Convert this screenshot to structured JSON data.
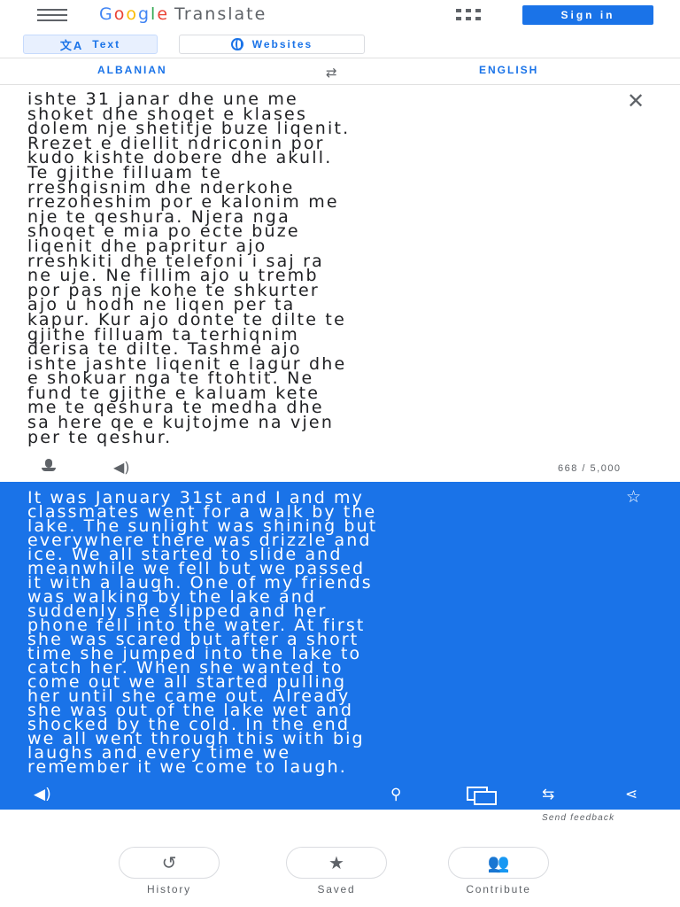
{
  "header": {
    "logo_letters": [
      "G",
      "o",
      "o",
      "g",
      "l",
      "e"
    ],
    "product": "Translate",
    "signin_label": "Sign in",
    "brand_color": "#1a73e8"
  },
  "modes": {
    "text_label": "Text",
    "websites_label": "Websites"
  },
  "languages": {
    "source": "ALBANIAN",
    "target": "ENGLISH"
  },
  "source": {
    "text": "ishte 31 janar dhe une me\nshoket dhe shoqet e klases\ndolem nje shetitje buze liqenit.\nRrezet e diellit ndriconin por\nkudo kishte dobere dhe akull.\nTe gjithe filluam te\nrreshqisnim dhe nderkohe\nrrezoheshim por e kalonim me\nnje te qeshura. Njera nga\nshoqet e mia po ecte buze\nliqenit dhe papritur ajo\nrreshkiti dhe telefoni i saj ra\nne uje. Ne fillim ajo u tremb\npor pas nje kohe te shkurter\najo u hodh ne liqen per ta\nkapur. Kur ajo donte te dilte te\ngjithe filluam ta terhiqnim\nderisa te dilte. Tashme ajo\nishte jashte liqenit e lagur dhe\ne shokuar nga te ftohtit. Ne\nfund te gjithe e kaluam kete\nme te qeshura te medha dhe\nsa here qe e kujtojme na vjen\nper te qeshur.",
    "char_count": "668 / 5,000"
  },
  "result": {
    "text": "It was January 31st and I and my\nclassmates went for a walk by the\nlake. The sunlight was shining but\neverywhere there was drizzle and\nice. We all started to slide and\nmeanwhile we fell but we passed\nit with a laugh. One of my friends\nwas walking by the lake and\nsuddenly she slipped and her\nphone fell into the water. At first\nshe was scared but after a short\ntime she jumped into the lake to\ncatch her. When she wanted to\ncome out we all started pulling\nher until she came out. Already\nshe was out of the lake wet and\nshocked by the cold. In the end\nwe all went through this with big\nlaughs and every time we\nremember it we come to laugh.",
    "background": "#1a73e8"
  },
  "feedback_label": "Send feedback",
  "bottom_nav": {
    "history": "History",
    "saved": "Saved",
    "contribute": "Contribute"
  },
  "icons": {
    "menu": "hamburger-menu-icon",
    "apps": "apps-grid-icon",
    "clear": "close-icon",
    "star": "star-outline-icon",
    "history": "history-icon",
    "saved": "star-filled-icon",
    "contribute": "people-icon"
  }
}
